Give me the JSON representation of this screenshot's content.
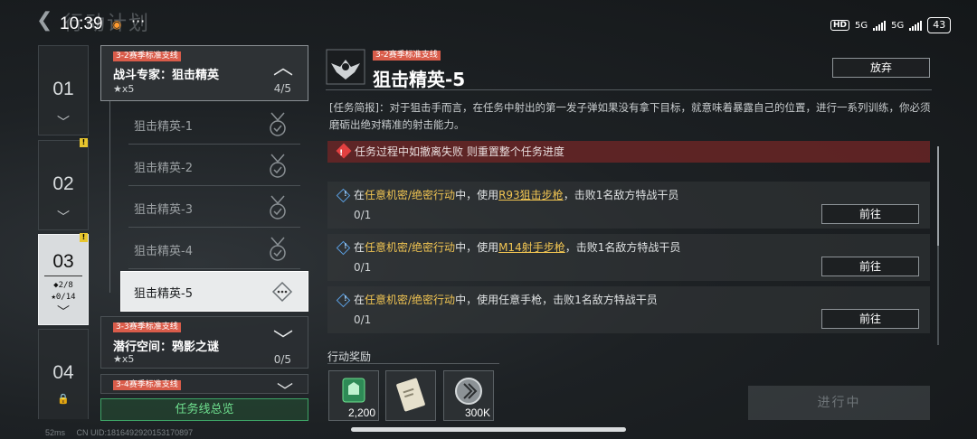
{
  "status_bar": {
    "time": "10:39",
    "dots": "···",
    "hd": "HD",
    "net1": "5G",
    "net2": "5G",
    "battery": "43"
  },
  "header": {
    "title": "行动计划"
  },
  "chapters": [
    {
      "num": "01"
    },
    {
      "num": "02"
    },
    {
      "num": "03",
      "diamonds": "◆2/8",
      "stars": "★0/14"
    },
    {
      "num": "04"
    }
  ],
  "quest_groups": [
    {
      "tag": "3-2赛季标准支线",
      "name": "战斗专家：狙击精英",
      "stars": "★x5",
      "progress": "4/5"
    },
    {
      "tag": "3-3赛季标准支线",
      "name": "潜行空间：鸦影之谜",
      "stars": "★x5",
      "progress": "0/5"
    },
    {
      "tag": "3-4赛季标准支线"
    }
  ],
  "sub_quests": [
    {
      "label": "狙击精英-1"
    },
    {
      "label": "狙击精英-2"
    },
    {
      "label": "狙击精英-3"
    },
    {
      "label": "狙击精英-4"
    },
    {
      "label": "狙击精英-5"
    }
  ],
  "overview_button": "任务线总览",
  "footer": {
    "ping": "52ms",
    "uid": "CN UID:1816492920153170897"
  },
  "detail": {
    "tag": "3-2赛季标准支线",
    "title": "狙击精英-5",
    "abandon": "放弃",
    "brief_label": "[任务简报]：",
    "brief": "对于狙击手而言，在任务中射出的第一发子弹如果没有拿下目标，就意味着暴露自己的位置，进行一系列训练，你必须磨砺出绝对精准的射击能力。",
    "warning": "任务过程中如撤离失败 则重置整个任务进度",
    "objectives": [
      {
        "pre": "在",
        "mode": "任意机密/绝密行动",
        "mid": "中，使用",
        "weapon": "R93狙击步枪",
        "post": "，击败1名敌方特战干员",
        "progress": "0/1",
        "go": "前往"
      },
      {
        "pre": "在",
        "mode": "任意机密/绝密行动",
        "mid": "中，使用",
        "weapon": "M14射手步枪",
        "post": "，击败1名敌方特战干员",
        "progress": "0/1",
        "go": "前往"
      },
      {
        "pre": "在",
        "mode": "任意机密/绝密行动",
        "mid": "中，使用任意手枪，击败1名敌方特战干员",
        "weapon": "",
        "post": "",
        "progress": "0/1",
        "go": "前往"
      }
    ],
    "rewards_label": "行动奖励",
    "rewards": [
      {
        "icon": "xp-card-icon",
        "count": "2,200"
      },
      {
        "icon": "document-item-icon",
        "count": ""
      },
      {
        "icon": "coin-icon",
        "count": "300K"
      }
    ],
    "in_progress": "进行中"
  },
  "colors": {
    "accent_green": "#3ea566",
    "tag_red": "#d95c4a",
    "highlight_yellow": "#f0c452",
    "warn_red": "#6e2626"
  }
}
